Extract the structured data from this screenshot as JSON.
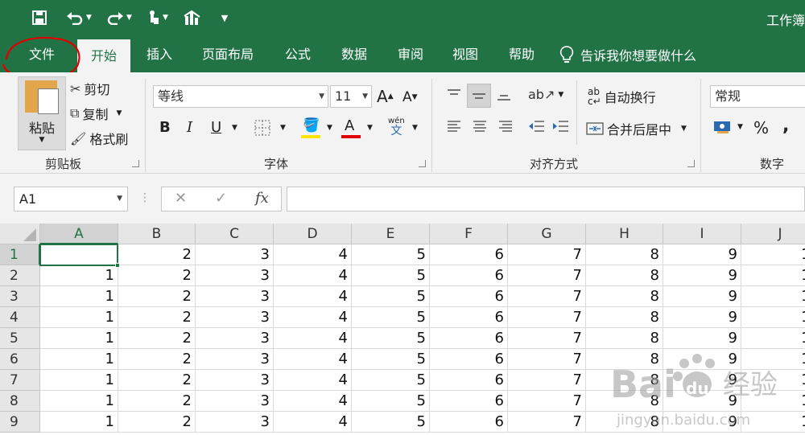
{
  "window": {
    "title": "工作簿"
  },
  "qat": {
    "save": "save-icon",
    "undo": "undo-icon",
    "redo": "redo-icon",
    "touch": "touch-mode-icon",
    "chart": "chart-icon",
    "customize": "customize-icon"
  },
  "tabs": [
    {
      "label": "文件",
      "active": false
    },
    {
      "label": "开始",
      "active": true
    },
    {
      "label": "插入",
      "active": false
    },
    {
      "label": "页面布局",
      "active": false
    },
    {
      "label": "公式",
      "active": false
    },
    {
      "label": "数据",
      "active": false
    },
    {
      "label": "审阅",
      "active": false
    },
    {
      "label": "视图",
      "active": false
    },
    {
      "label": "帮助",
      "active": false
    }
  ],
  "tell_me": {
    "label": "告诉我你想要做什么"
  },
  "clipboard": {
    "paste": "粘贴",
    "cut": "剪切",
    "copy": "复制",
    "format_painter": "格式刷",
    "group": "剪贴板"
  },
  "font": {
    "name": "等线",
    "size": "11",
    "bold": "B",
    "italic": "I",
    "underline": "U",
    "group": "字体",
    "phonetic_top": "wén",
    "phonetic_bottom": "文",
    "font_color": "#e00000",
    "fill_color": "#ffe600"
  },
  "alignment": {
    "wrap": "自动换行",
    "merge": "合并后居中",
    "group": "对齐方式"
  },
  "number": {
    "format": "常规",
    "percent": "%",
    "comma": ",",
    "group": "数字"
  },
  "formula_bar": {
    "name_box": "A1",
    "cancel": "✕",
    "enter": "✓",
    "fx": "fx",
    "value": ""
  },
  "columns": [
    "A",
    "B",
    "C",
    "D",
    "E",
    "F",
    "G",
    "H",
    "I",
    "J"
  ],
  "rows": [
    {
      "num": "1",
      "cells": [
        "",
        "2",
        "3",
        "4",
        "5",
        "6",
        "7",
        "8",
        "9",
        "1"
      ]
    },
    {
      "num": "2",
      "cells": [
        "1",
        "2",
        "3",
        "4",
        "5",
        "6",
        "7",
        "8",
        "9",
        "1"
      ]
    },
    {
      "num": "3",
      "cells": [
        "1",
        "2",
        "3",
        "4",
        "5",
        "6",
        "7",
        "8",
        "9",
        "1"
      ]
    },
    {
      "num": "4",
      "cells": [
        "1",
        "2",
        "3",
        "4",
        "5",
        "6",
        "7",
        "8",
        "9",
        "1"
      ]
    },
    {
      "num": "5",
      "cells": [
        "1",
        "2",
        "3",
        "4",
        "5",
        "6",
        "7",
        "8",
        "9",
        "1"
      ]
    },
    {
      "num": "6",
      "cells": [
        "1",
        "2",
        "3",
        "4",
        "5",
        "6",
        "7",
        "8",
        "9",
        "1"
      ]
    },
    {
      "num": "7",
      "cells": [
        "1",
        "2",
        "3",
        "4",
        "5",
        "6",
        "7",
        "8",
        "9",
        "1"
      ]
    },
    {
      "num": "8",
      "cells": [
        "1",
        "2",
        "3",
        "4",
        "5",
        "6",
        "7",
        "8",
        "9",
        "1"
      ]
    },
    {
      "num": "9",
      "cells": [
        "1",
        "2",
        "3",
        "4",
        "5",
        "6",
        "7",
        "8",
        "9",
        "1"
      ]
    }
  ],
  "watermark": {
    "brand": "Bai",
    "brand2": "du",
    "suffix": "经验",
    "url": "jingyan.baidu.com"
  },
  "colors": {
    "accent": "#217346",
    "annotation": "#e00000"
  }
}
